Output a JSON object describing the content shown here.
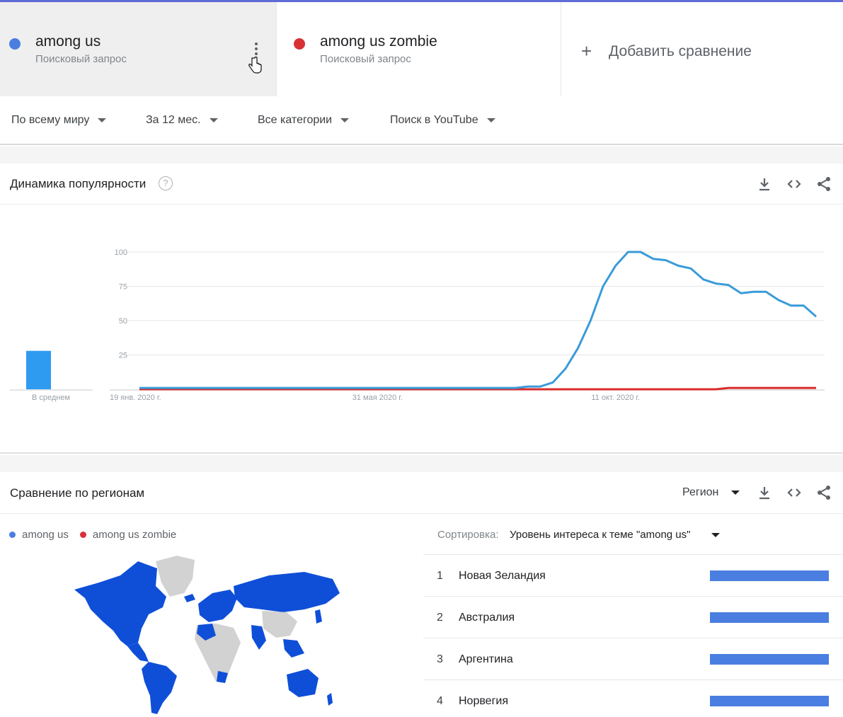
{
  "colors": {
    "term1": "#4a7ee0",
    "term2": "#d93036",
    "line1": "#3a9bd9",
    "line2": "#d92b2b",
    "map_fill": "#0f4fd8",
    "map_gray": "#d2d2d2"
  },
  "terms": [
    {
      "name": "among us",
      "type": "Поисковый запрос"
    },
    {
      "name": "among us zombie",
      "type": "Поисковый запрос"
    }
  ],
  "add_compare": "Добавить сравнение",
  "filters": [
    "По всему миру",
    "За 12 мес.",
    "Все категории",
    "Поиск в YouTube"
  ],
  "interest": {
    "title": "Динамика популярности",
    "help": "?",
    "average_label": "В среднем",
    "tools": [
      "download-icon",
      "embed-icon",
      "share-icon"
    ]
  },
  "chart_data": {
    "type": "line",
    "title": "",
    "xlabel": "",
    "ylabel": "",
    "ylim": [
      0,
      100
    ],
    "y_ticks": [
      100,
      75,
      50,
      25
    ],
    "x_tick_labels": [
      "19 янв. 2020 г.",
      "31 мая 2020 г.",
      "11 окт. 2020 г."
    ],
    "x_tick_index": [
      0,
      19,
      38
    ],
    "x_count": 54,
    "series": [
      {
        "values": [
          1,
          1,
          1,
          1,
          1,
          1,
          1,
          1,
          1,
          1,
          1,
          1,
          1,
          1,
          1,
          1,
          1,
          1,
          1,
          1,
          1,
          1,
          1,
          1,
          1,
          1,
          1,
          1,
          1,
          1,
          1,
          2,
          2,
          5,
          15,
          30,
          50,
          75,
          90,
          100,
          100,
          95,
          94,
          90,
          88,
          80,
          77,
          76,
          70,
          71,
          71,
          65,
          61,
          61,
          53
        ]
      },
      {
        "values": [
          0,
          0,
          0,
          0,
          0,
          0,
          0,
          0,
          0,
          0,
          0,
          0,
          0,
          0,
          0,
          0,
          0,
          0,
          0,
          0,
          0,
          0,
          0,
          0,
          0,
          0,
          0,
          0,
          0,
          0,
          0,
          0,
          0,
          0,
          0,
          0,
          0,
          0,
          0,
          0,
          0,
          0,
          0,
          0,
          0,
          0,
          0,
          1,
          1,
          1,
          1,
          1,
          1,
          1,
          1
        ]
      }
    ],
    "average_bar": 28
  },
  "regions": {
    "title": "Сравнение по регионам",
    "region_select": "Регион",
    "legend": [
      "among us",
      "among us zombie"
    ],
    "sort_label": "Сортировка:",
    "sort_value": "Уровень интереса к теме \"among us\"",
    "rows": [
      {
        "rank": "1",
        "country": "Новая Зеландия"
      },
      {
        "rank": "2",
        "country": "Австралия"
      },
      {
        "rank": "3",
        "country": "Аргентина"
      },
      {
        "rank": "4",
        "country": "Норвегия"
      }
    ]
  }
}
